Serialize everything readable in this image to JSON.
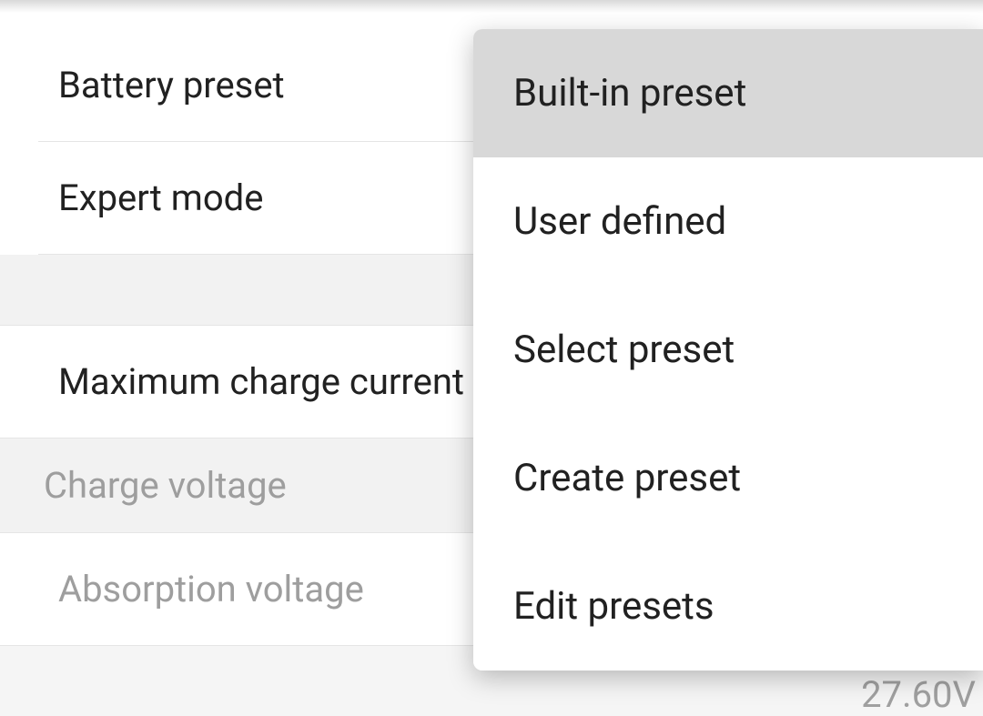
{
  "settings": {
    "battery_preset": {
      "label": "Battery preset"
    },
    "expert_mode": {
      "label": "Expert mode"
    },
    "max_charge_current": {
      "label": "Maximum charge current"
    },
    "charge_voltage_header": "Charge voltage",
    "absorption_voltage": {
      "label": "Absorption voltage"
    },
    "partial_value": "27.60V"
  },
  "popup": {
    "items": [
      {
        "label": "Built-in preset",
        "selected": true
      },
      {
        "label": "User defined",
        "selected": false
      },
      {
        "label": "Select preset",
        "selected": false
      },
      {
        "label": "Create preset",
        "selected": false
      },
      {
        "label": "Edit presets",
        "selected": false
      }
    ]
  }
}
